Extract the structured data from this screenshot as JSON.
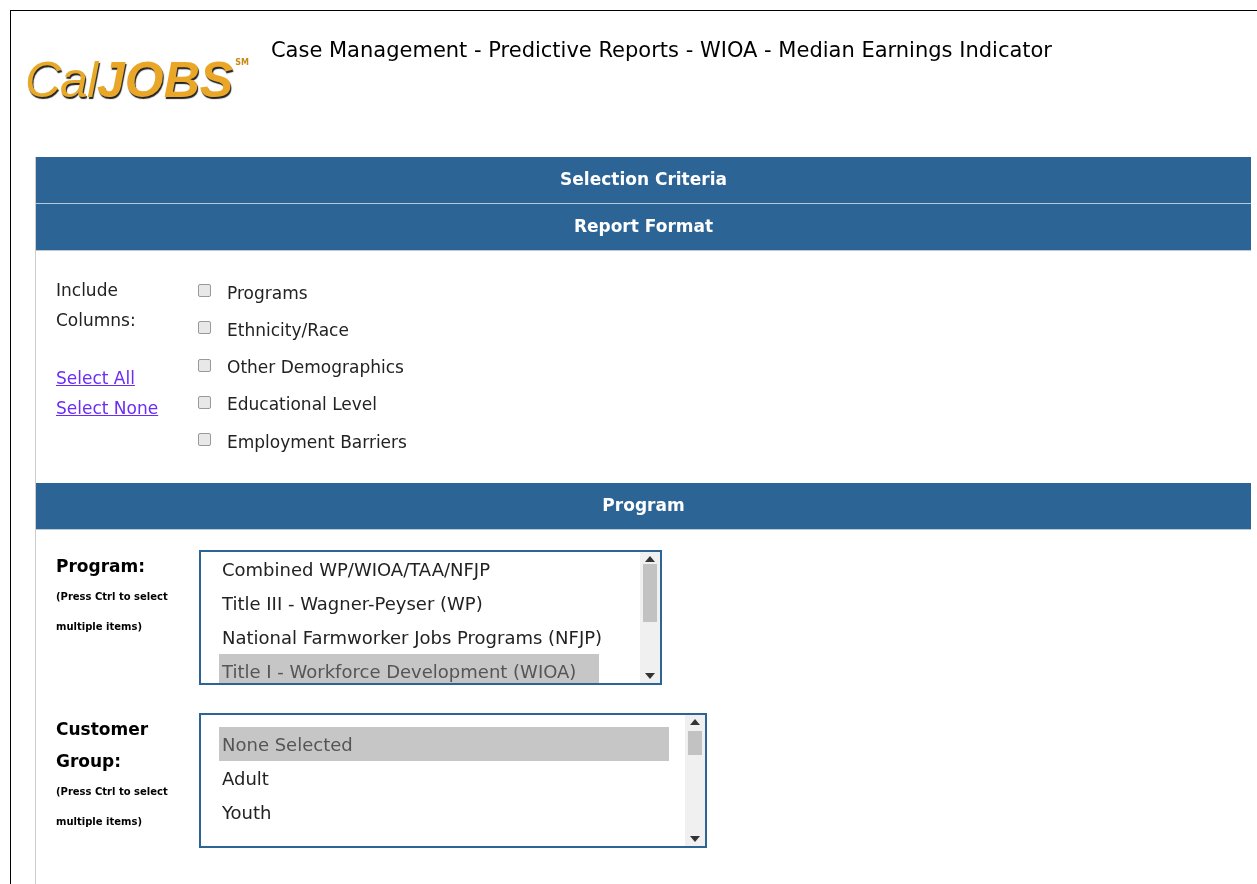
{
  "logo": {
    "part_1": "Cal",
    "part_2": "JOBS",
    "mark": "SM"
  },
  "title": "Case Management - Predictive Reports - WIOA - Median Earnings Indicator",
  "sections": [
    {
      "title": "Selection Criteria"
    },
    {
      "title": "Report Format"
    }
  ],
  "report_format": {
    "label_lines": [
      "Include",
      "Columns:"
    ],
    "links": [
      "Select All",
      "Select None"
    ],
    "options": [
      {
        "label": "Programs",
        "checked": false
      },
      {
        "label": "Ethnicity/Race",
        "checked": false
      },
      {
        "label": "Other Demographics",
        "checked": false
      },
      {
        "label": "Educational Level",
        "checked": false
      },
      {
        "label": "Employment Barriers",
        "checked": false
      }
    ]
  },
  "program_section": {
    "title": "Program"
  },
  "lists": [
    {
      "label": "Program:",
      "hint_lines": [
        "(Press Ctrl to select",
        "multiple items)"
      ],
      "items": [
        {
          "label": "Combined WP/WIOA/TAA/NFJP",
          "selected": false
        },
        {
          "label": "Title III - Wagner-Peyser (WP)",
          "selected": false
        },
        {
          "label": "National Farmworker Jobs Programs (NFJP)",
          "selected": false
        },
        {
          "label": "Title I - Workforce Development (WIOA)",
          "selected": true
        }
      ]
    },
    {
      "label_lines": [
        "Customer",
        "Group:"
      ],
      "hint_lines": [
        "(Press Ctrl to select",
        "multiple items)"
      ],
      "items": [
        {
          "label": "None Selected",
          "selected": true
        },
        {
          "label": "Adult",
          "selected": false
        },
        {
          "label": "Youth",
          "selected": false
        }
      ]
    }
  ]
}
